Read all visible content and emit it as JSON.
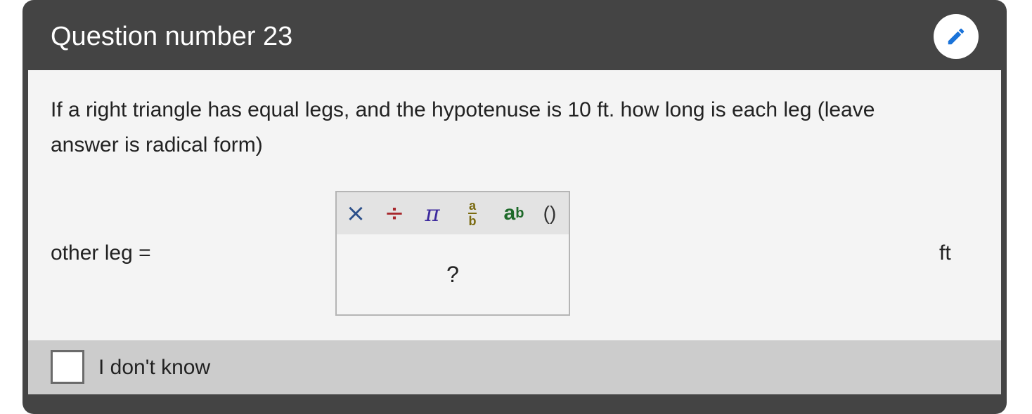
{
  "header": {
    "title": "Question number 23",
    "edit_icon": "pencil-icon",
    "edit_icon_color": "#1a73d9"
  },
  "question": {
    "text": "If a right triangle has equal legs, and the hypotenuse is 10 ft. how long is each leg (leave answer is radical form)"
  },
  "answer_row": {
    "label": "other leg =",
    "unit": "ft",
    "placeholder": "?"
  },
  "math_toolbar": {
    "times": "×",
    "divide": "÷",
    "pi": "π",
    "fraction_numerator": "a",
    "fraction_denominator": "b",
    "power_base": "a",
    "power_exponent": "b",
    "parentheses": "()"
  },
  "footer": {
    "dont_know_label": "I don't know",
    "checked": false
  },
  "colors": {
    "header_bg": "#444444",
    "panel_bg": "#f4f4f4",
    "footer_bg": "#cccccc"
  }
}
